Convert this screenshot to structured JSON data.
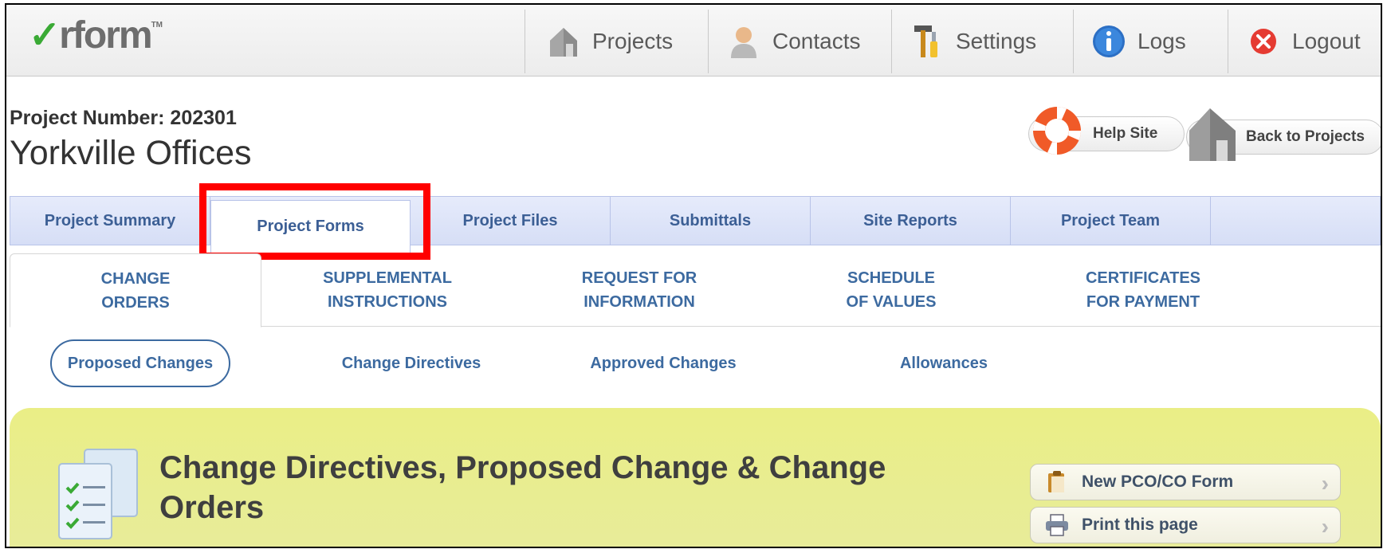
{
  "app": {
    "logo_text": "rform",
    "logo_check": "✓",
    "logo_tm": "TM"
  },
  "nav": {
    "items": [
      {
        "label": "Projects",
        "icon": "house-icon"
      },
      {
        "label": "Contacts",
        "icon": "person-icon"
      },
      {
        "label": "Settings",
        "icon": "tools-icon"
      },
      {
        "label": "Logs",
        "icon": "info-icon"
      },
      {
        "label": "Logout",
        "icon": "close-icon"
      }
    ]
  },
  "project": {
    "number_label": "Project Number: 202301",
    "name": "Yorkville Offices"
  },
  "header_buttons": {
    "help": "Help Site",
    "back": "Back to Projects"
  },
  "primary_tabs": [
    {
      "label": "Project Summary"
    },
    {
      "label": "Project Forms",
      "active": true
    },
    {
      "label": "Project Files"
    },
    {
      "label": "Submittals"
    },
    {
      "label": "Site Reports"
    },
    {
      "label": "Project Team"
    }
  ],
  "secondary_tabs": [
    {
      "line1": "CHANGE",
      "line2": "ORDERS",
      "active": true
    },
    {
      "line1": "SUPPLEMENTAL",
      "line2": "INSTRUCTIONS"
    },
    {
      "line1": "REQUEST FOR",
      "line2": "INFORMATION"
    },
    {
      "line1": "SCHEDULE",
      "line2": "OF VALUES"
    },
    {
      "line1": "CERTIFICATES",
      "line2": "FOR PAYMENT"
    }
  ],
  "sub_tabs": [
    {
      "label": "Proposed Changes",
      "active": true
    },
    {
      "label": "Change Directives"
    },
    {
      "label": "Approved Changes"
    },
    {
      "label": "Allowances"
    }
  ],
  "banner": {
    "title": "Change Directives, Proposed Change & Change Orders",
    "actions": [
      {
        "label": "New PCO/CO Form",
        "icon": "clipboard-icon"
      },
      {
        "label": "Print this page",
        "icon": "printer-icon"
      }
    ]
  },
  "colors": {
    "accent_blue": "#3c6aa0",
    "highlight_red": "#ff0000",
    "banner_yellow": "#eaee86"
  }
}
